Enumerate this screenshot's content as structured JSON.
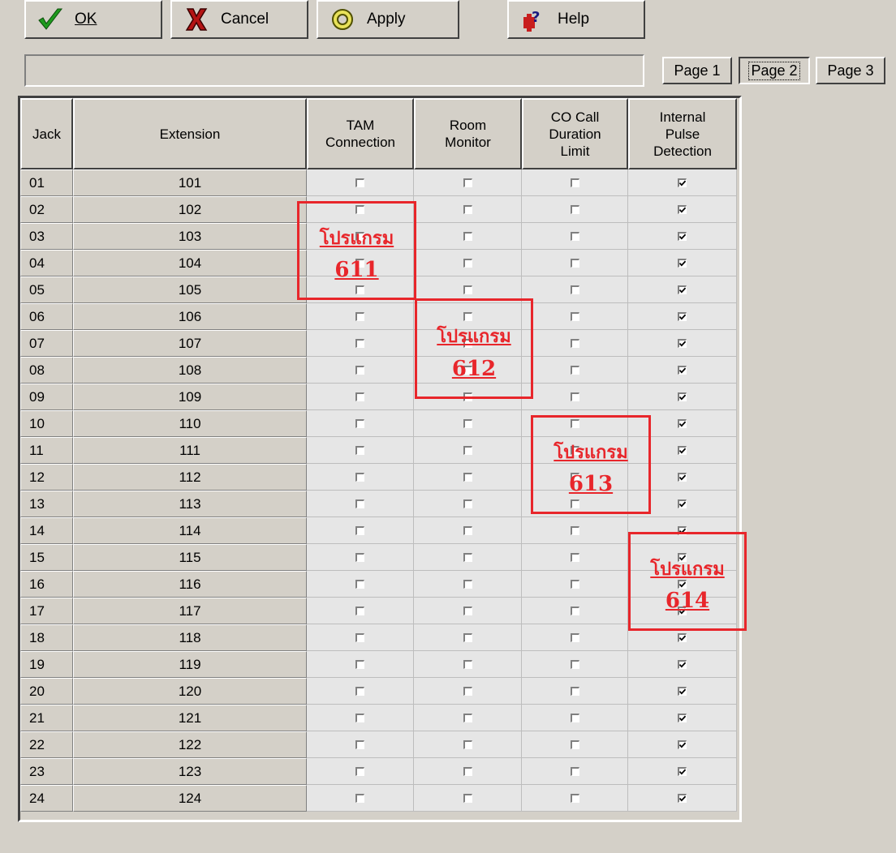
{
  "toolbar": {
    "ok_label": "OK",
    "cancel_label": "Cancel",
    "apply_label": "Apply",
    "help_label": "Help",
    "icons": {
      "ok": "checkmark-icon",
      "cancel": "x-icon",
      "apply": "apply-ring-icon",
      "help": "help-icon"
    }
  },
  "status_text": "",
  "pages": {
    "page1": "Page 1",
    "page2": "Page 2",
    "page3": "Page 3",
    "active": "Page 2"
  },
  "table": {
    "headers": {
      "jack": "Jack",
      "extension": "Extension",
      "tam": "TAM\nConnection",
      "room": "Room\nMonitor",
      "co": "CO Call\nDuration\nLimit",
      "pulse": "Internal\nPulse\nDetection"
    },
    "rows": [
      {
        "jack": "01",
        "ext": "101",
        "tam": false,
        "room": false,
        "co": false,
        "pulse": true
      },
      {
        "jack": "02",
        "ext": "102",
        "tam": false,
        "room": false,
        "co": false,
        "pulse": true
      },
      {
        "jack": "03",
        "ext": "103",
        "tam": false,
        "room": false,
        "co": false,
        "pulse": true
      },
      {
        "jack": "04",
        "ext": "104",
        "tam": false,
        "room": false,
        "co": false,
        "pulse": true
      },
      {
        "jack": "05",
        "ext": "105",
        "tam": false,
        "room": false,
        "co": false,
        "pulse": true
      },
      {
        "jack": "06",
        "ext": "106",
        "tam": false,
        "room": false,
        "co": false,
        "pulse": true
      },
      {
        "jack": "07",
        "ext": "107",
        "tam": false,
        "room": false,
        "co": false,
        "pulse": true
      },
      {
        "jack": "08",
        "ext": "108",
        "tam": false,
        "room": false,
        "co": false,
        "pulse": true
      },
      {
        "jack": "09",
        "ext": "109",
        "tam": false,
        "room": false,
        "co": false,
        "pulse": true
      },
      {
        "jack": "10",
        "ext": "110",
        "tam": false,
        "room": false,
        "co": false,
        "pulse": true
      },
      {
        "jack": "11",
        "ext": "111",
        "tam": false,
        "room": false,
        "co": false,
        "pulse": true
      },
      {
        "jack": "12",
        "ext": "112",
        "tam": false,
        "room": false,
        "co": false,
        "pulse": true
      },
      {
        "jack": "13",
        "ext": "113",
        "tam": false,
        "room": false,
        "co": false,
        "pulse": true
      },
      {
        "jack": "14",
        "ext": "114",
        "tam": false,
        "room": false,
        "co": false,
        "pulse": true
      },
      {
        "jack": "15",
        "ext": "115",
        "tam": false,
        "room": false,
        "co": false,
        "pulse": true
      },
      {
        "jack": "16",
        "ext": "116",
        "tam": false,
        "room": false,
        "co": false,
        "pulse": true
      },
      {
        "jack": "17",
        "ext": "117",
        "tam": false,
        "room": false,
        "co": false,
        "pulse": true
      },
      {
        "jack": "18",
        "ext": "118",
        "tam": false,
        "room": false,
        "co": false,
        "pulse": true
      },
      {
        "jack": "19",
        "ext": "119",
        "tam": false,
        "room": false,
        "co": false,
        "pulse": true
      },
      {
        "jack": "20",
        "ext": "120",
        "tam": false,
        "room": false,
        "co": false,
        "pulse": true
      },
      {
        "jack": "21",
        "ext": "121",
        "tam": false,
        "room": false,
        "co": false,
        "pulse": true
      },
      {
        "jack": "22",
        "ext": "122",
        "tam": false,
        "room": false,
        "co": false,
        "pulse": true
      },
      {
        "jack": "23",
        "ext": "123",
        "tam": false,
        "room": false,
        "co": false,
        "pulse": true
      },
      {
        "jack": "24",
        "ext": "124",
        "tam": false,
        "room": false,
        "co": false,
        "pulse": true
      }
    ]
  },
  "annotations": [
    {
      "label": "โปรแกรม",
      "number": "611"
    },
    {
      "label": "โปรแกรม",
      "number": "612"
    },
    {
      "label": "โปรแกรม",
      "number": "613"
    },
    {
      "label": "โปรแกรม",
      "number": "614"
    }
  ],
  "colors": {
    "annotation": "#e8262b",
    "window_bg": "#d4d0c8",
    "cell_bg": "#e6e6e6"
  }
}
